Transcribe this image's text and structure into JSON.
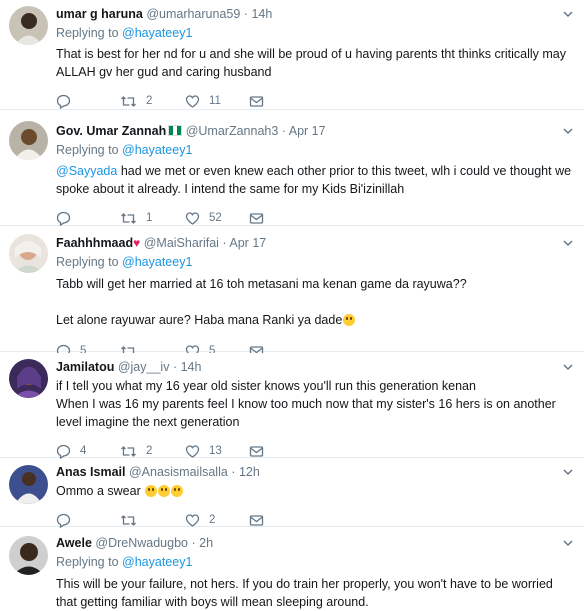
{
  "tweets": [
    {
      "name": "umar g haruna",
      "handle": "@umarharuna59",
      "time": "14h",
      "replying_label": "Replying to",
      "replying_to": "@hayateey1",
      "text": "That is best for her nd for u and she will be proud of u having parents tht thinks critically may ALLAH gv her gud and caring husband",
      "replies": "",
      "retweets": "2",
      "likes": "11"
    },
    {
      "name": "Gov. Umar Zannah",
      "handle": "@UmarZannah3",
      "time": "Apr 17",
      "replying_label": "Replying to",
      "replying_to": "@hayateey1",
      "mention": "@Sayyada",
      "text": " had we met or even knew each other prior to this tweet, wlh i could ve thought we spoke about it already. I intend the same for my Kids Bi'izinillah",
      "replies": "",
      "retweets": "1",
      "likes": "52"
    },
    {
      "name": "Faahhhmaad",
      "handle": "@MaiSharifai",
      "time": "Apr 17",
      "replying_label": "Replying to",
      "replying_to": "@hayateey1",
      "text_line1": "Tabb will get her married at 16 toh metasani ma kenan game da rayuwa??",
      "text_line2": "Let alone rayuwar aure? Haba mana Ranki ya dade",
      "replies": "5",
      "retweets": "",
      "likes": "5"
    },
    {
      "name": "Jamilatou",
      "handle": "@jay__iv",
      "time": "14h",
      "text": "if I tell you what my 16 year old sister knows you'll run this generation kenan\nWhen I was 16 my parents feel I know too much now that my sister's 16 hers is on another level imagine the next generation",
      "replies": "4",
      "retweets": "2",
      "likes": "13"
    },
    {
      "name": "Anas Ismail",
      "handle": "@Anasismailsalla",
      "time": "12h",
      "text": "Ommo a swear",
      "replies": "",
      "retweets": "",
      "likes": "2"
    },
    {
      "name": "Awele",
      "handle": "@DreNwadugbo",
      "time": "2h",
      "replying_label": "Replying to",
      "replying_to": "@hayateey1",
      "text": "This will be your failure, not hers. If you do train her properly, you won't have to be worried that getting familiar with boys will mean sleeping around."
    }
  ],
  "separator": "·",
  "colors": {
    "link": "#1b95e0",
    "muted": "#657786",
    "divider": "#e6ecf0",
    "like_red": "#e0245e"
  },
  "icons": [
    "reply-icon",
    "retweet-icon",
    "like-icon",
    "message-icon",
    "chevron-down-icon",
    "red-heart-emoji",
    "nigeria-flag-emoji",
    "grinning-face-emoji",
    "tears-of-joy-emoji"
  ]
}
